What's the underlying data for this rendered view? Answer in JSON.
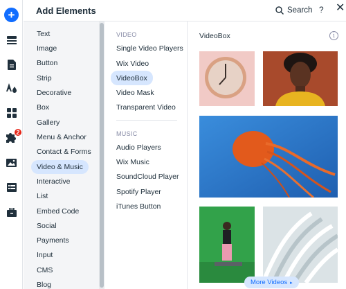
{
  "header": {
    "title": "Add Elements",
    "search_label": "Search",
    "help_label": "?",
    "close_label": "✕"
  },
  "rail": {
    "add_label": "+",
    "badge_count": "2",
    "icons": [
      "add-icon",
      "menu-icon",
      "page-icon",
      "theme-icon",
      "apps-grid-icon",
      "puzzle-icon",
      "media-icon",
      "table-icon",
      "briefcase-icon"
    ]
  },
  "categories": [
    {
      "label": "Text"
    },
    {
      "label": "Image"
    },
    {
      "label": "Button"
    },
    {
      "label": "Strip"
    },
    {
      "label": "Decorative"
    },
    {
      "label": "Box"
    },
    {
      "label": "Gallery"
    },
    {
      "label": "Menu & Anchor"
    },
    {
      "label": "Contact & Forms"
    },
    {
      "label": "Video & Music",
      "active": true
    },
    {
      "label": "Interactive"
    },
    {
      "label": "List"
    },
    {
      "label": "Embed Code"
    },
    {
      "label": "Social"
    },
    {
      "label": "Payments"
    },
    {
      "label": "Input"
    },
    {
      "label": "CMS"
    },
    {
      "label": "Blog"
    }
  ],
  "video_section": {
    "title": "VIDEO",
    "items": [
      {
        "label": "Single Video Players"
      },
      {
        "label": "Wix Video"
      },
      {
        "label": "VideoBox",
        "active": true
      },
      {
        "label": "Video Mask"
      },
      {
        "label": "Transparent Video"
      }
    ]
  },
  "music_section": {
    "title": "MUSIC",
    "items": [
      {
        "label": "Audio Players"
      },
      {
        "label": "Wix Music"
      },
      {
        "label": "SoundCloud Player"
      },
      {
        "label": "Spotify Player"
      },
      {
        "label": "iTunes Button"
      }
    ]
  },
  "preview": {
    "title": "VideoBox",
    "info_label": "i",
    "more_label": "More Videos",
    "more_arrow": "▸"
  },
  "colors": {
    "accent": "#116dff",
    "active_bg": "#d6e6fe",
    "badge": "#e62214",
    "category_bg": "#f4f5f7"
  }
}
